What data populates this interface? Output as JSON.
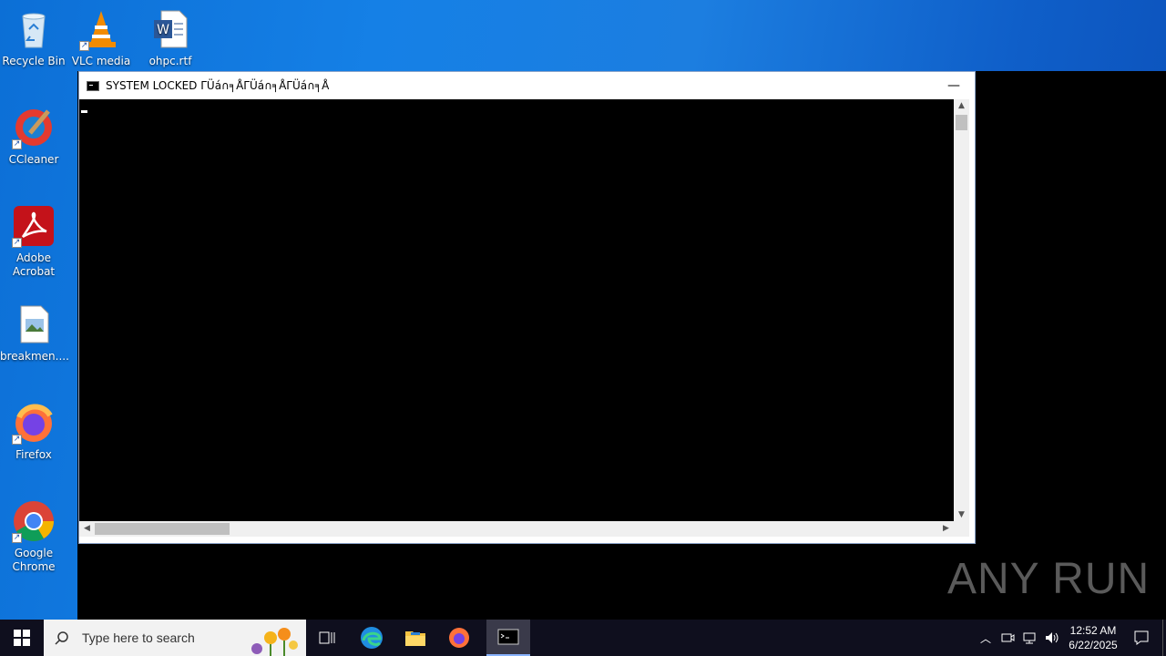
{
  "desktop": {
    "icons": [
      {
        "label": "Recycle Bin"
      },
      {
        "label": "VLC media"
      },
      {
        "label": "ohpc.rtf"
      },
      {
        "label": "CCleaner"
      },
      {
        "label": "Adobe Acrobat"
      },
      {
        "label": "breakmen...."
      },
      {
        "label": "Firefox"
      },
      {
        "label": "Google Chrome"
      }
    ]
  },
  "window": {
    "title": "SYSTEM LOCKED ΓÜá∩╕ÅΓÜá∩╕ÅΓÜá∩╕Å",
    "minimize_label": "—"
  },
  "taskbar": {
    "search_placeholder": "Type here to search",
    "time": "12:52 AM",
    "date": "6/22/2025"
  },
  "watermark": "ANY RUN"
}
